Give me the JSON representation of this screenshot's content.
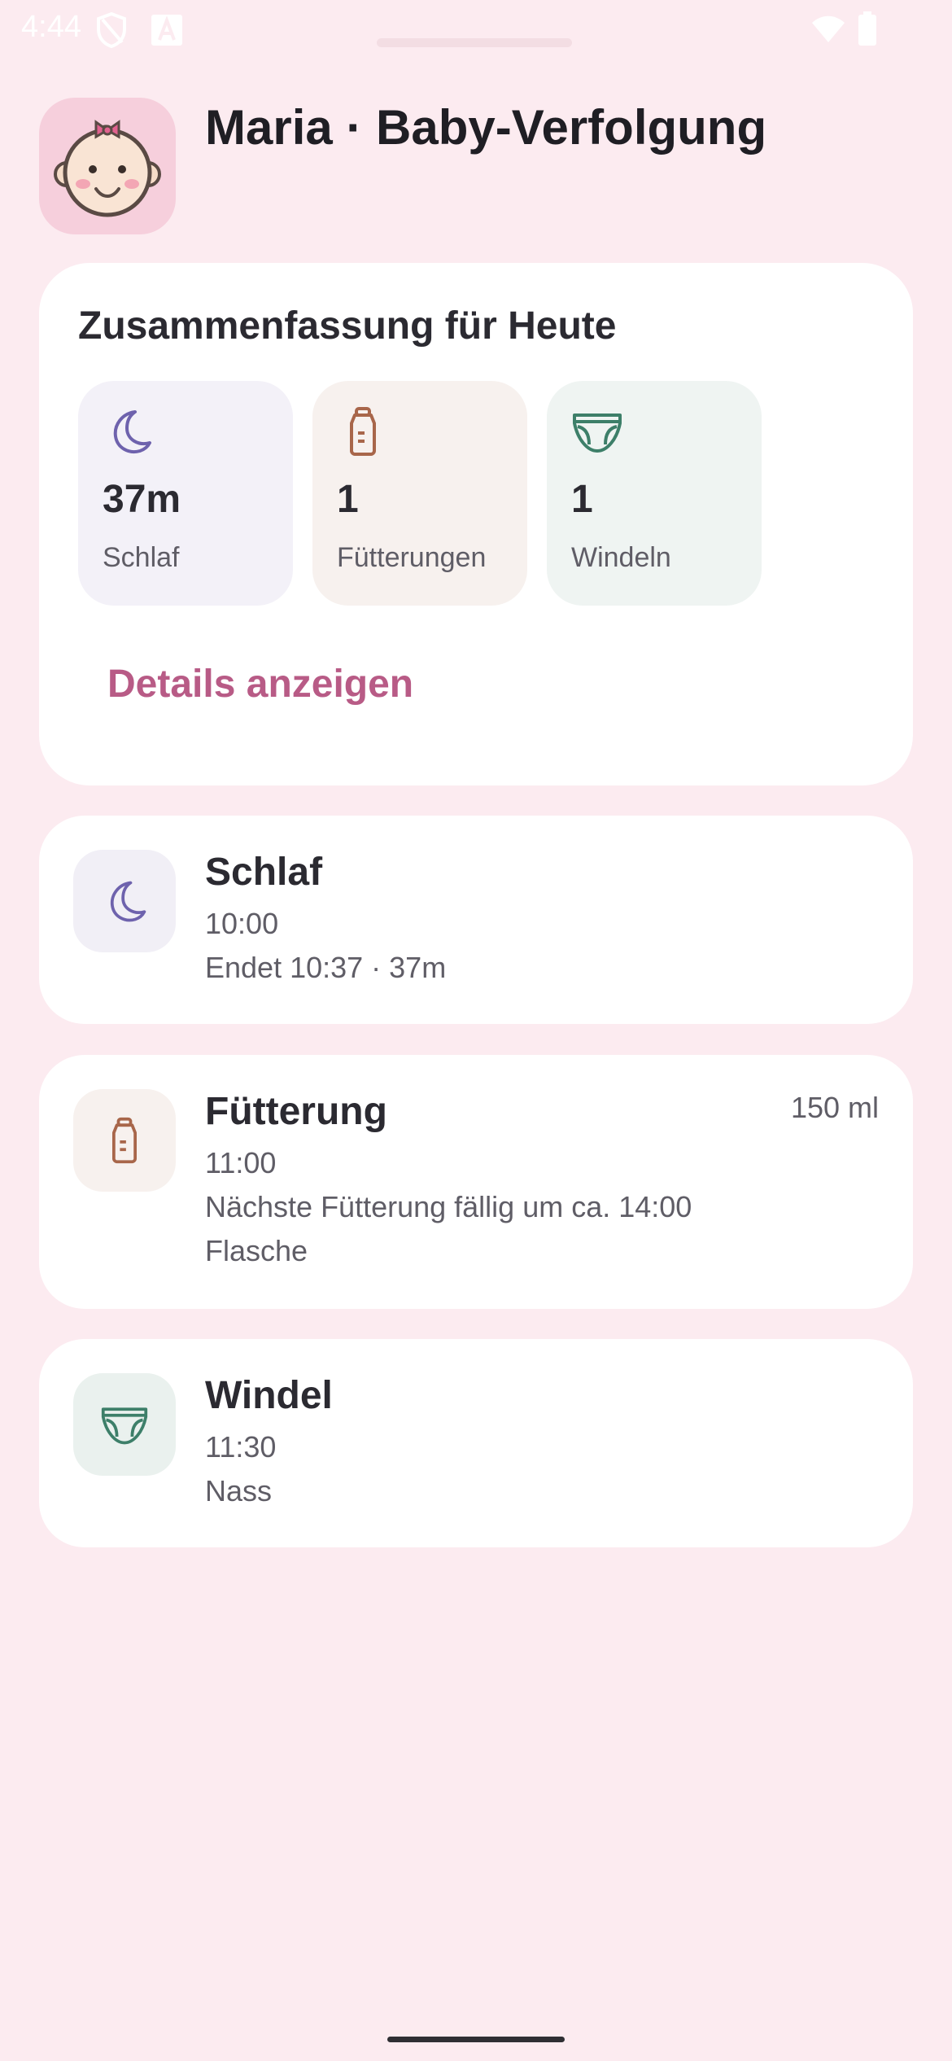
{
  "status_bar": {
    "time": "4:44",
    "icons": [
      "shield-icon",
      "font-a-icon",
      "wifi-icon",
      "battery-icon"
    ]
  },
  "header": {
    "title": "Maria · Baby-Verfolgung",
    "avatar_icon": "baby-face-icon"
  },
  "summary": {
    "title": "Zusammenfassung für Heute",
    "stats": [
      {
        "icon": "moon-icon",
        "value": "37m",
        "label": "Schlaf",
        "bg": "#f3f1f8",
        "color": "#6e62ad"
      },
      {
        "icon": "bottle-icon",
        "value": "1",
        "label": "Fütterungen",
        "bg": "#f7f1ee",
        "color": "#a8664a"
      },
      {
        "icon": "diaper-icon",
        "value": "1",
        "label": "Windeln",
        "bg": "#eff4f2",
        "color": "#3d7f69"
      }
    ],
    "details_label": "Details anzeigen"
  },
  "events": [
    {
      "icon": "moon-icon",
      "title": "Schlaf",
      "lines": [
        "10:00",
        "Endet 10:37 · 37m"
      ],
      "amount": ""
    },
    {
      "icon": "bottle-icon",
      "title": "Fütterung",
      "lines": [
        "11:00",
        "Nächste Fütterung fällig um ca. 14:00",
        "Flasche"
      ],
      "amount": "150 ml"
    },
    {
      "icon": "diaper-icon",
      "title": "Windel",
      "lines": [
        "11:30",
        "Nass"
      ],
      "amount": ""
    }
  ],
  "colors": {
    "background": "#fcebf0",
    "accent": "#b85b86",
    "sleep": "#6e62ad",
    "feeding": "#a8664a",
    "diaper": "#3d7f69"
  }
}
